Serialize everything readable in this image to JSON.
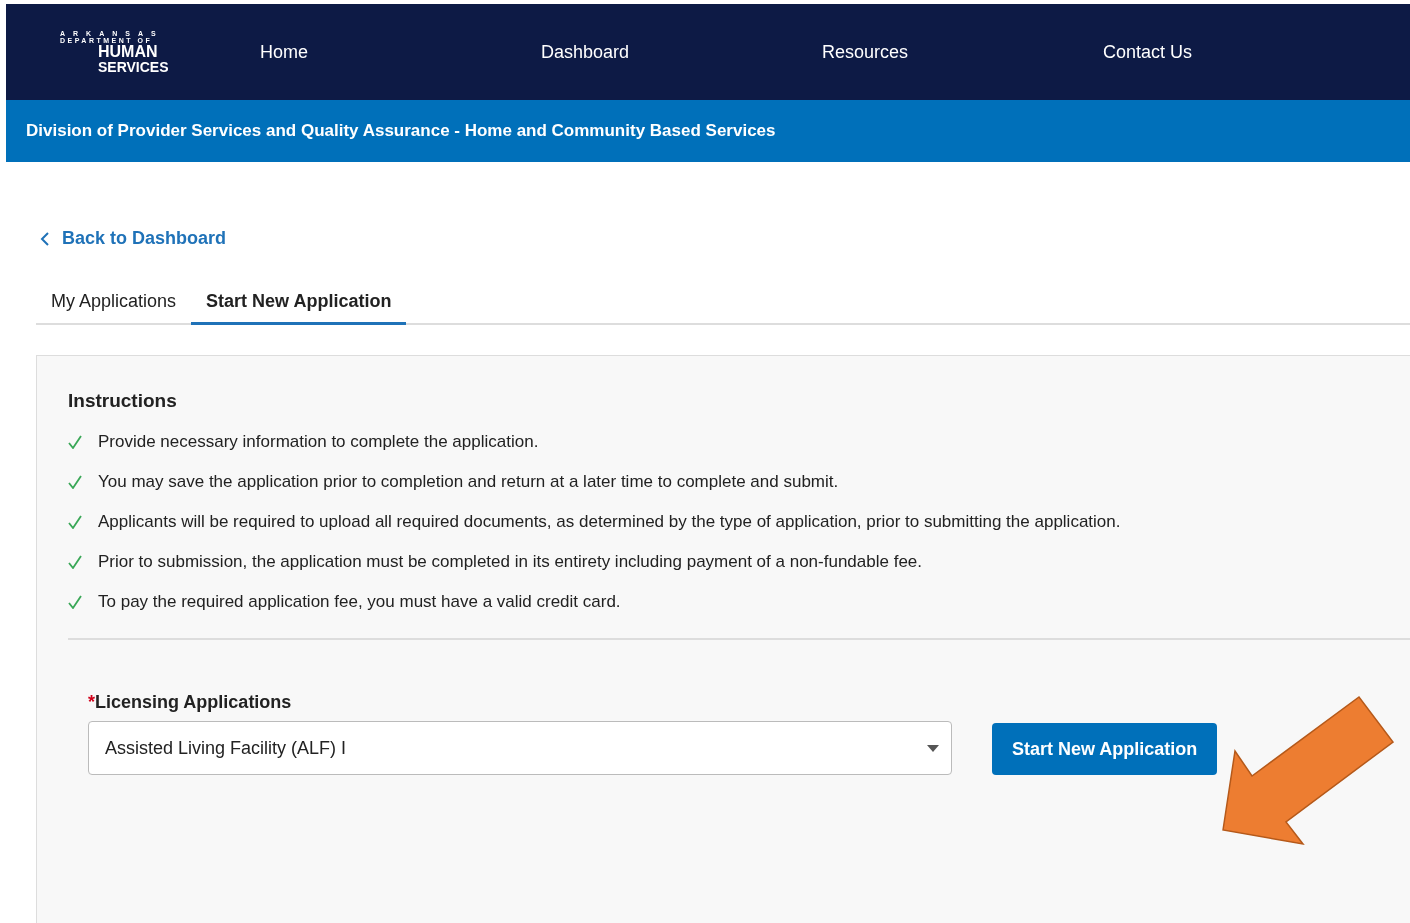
{
  "logo": {
    "lines": [
      "ARKANSAS",
      "DEPARTMENT OF",
      "HUMAN",
      "SERVICES"
    ]
  },
  "nav": [
    "Home",
    "Dashboard",
    "Resources",
    "Contact Us"
  ],
  "banner": "Division of Provider Services and Quality Assurance - Home and Community Based Services",
  "back_link": "Back to Dashboard",
  "tabs": [
    {
      "label": "My Applications",
      "selected": false
    },
    {
      "label": "Start New Application",
      "selected": true
    }
  ],
  "instructions": {
    "title": "Instructions",
    "items": [
      {
        "text": "Provide necessary information to complete the application.",
        "checked": true
      },
      {
        "text": "You may save the application prior to completion and return at a later time to complete and submit.",
        "checked": true
      },
      {
        "text": "Applicants will be required to upload all required documents, as determined by the type of application, prior to submitting the application.",
        "checked": true
      },
      {
        "text": "Prior to submission, the application must be completed in its entirety including payment of a non-fundable fee.",
        "checked": true
      },
      {
        "text": "To pay the required application fee, you must have a valid credit card.",
        "checked": true
      }
    ]
  },
  "form": {
    "required_mark": "*",
    "label": "Licensing Applications",
    "value": "Assisted Living Facility (ALF) I",
    "button": "Start New Application"
  }
}
